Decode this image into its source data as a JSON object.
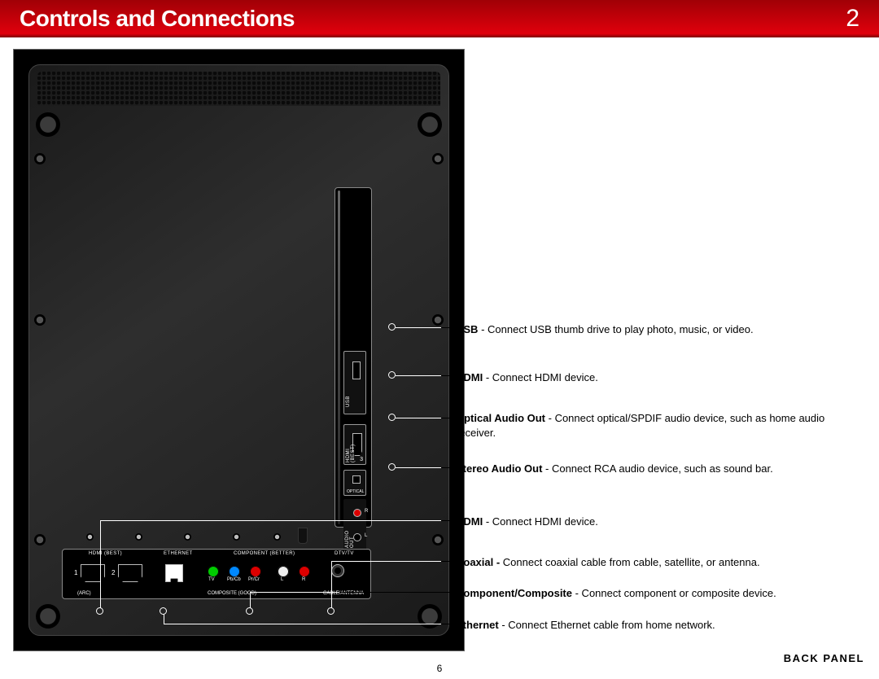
{
  "header": {
    "title": "Controls and Connections",
    "chapter": "2"
  },
  "side_ports": {
    "usb": {
      "label_v": "USB"
    },
    "hdmi": {
      "label_v": "HDMI (BEST)",
      "num": "3"
    },
    "optical": {
      "label_v": "OPTICAL"
    },
    "audio": {
      "label_v": "AUDIO OUT",
      "r": "R",
      "l": "L"
    }
  },
  "bottom_ports": {
    "hdmi_label": "HDMI (BEST)",
    "hdmi1": "1",
    "hdmi2": "2",
    "arc": "(ARC)",
    "eth_label": "ETHERNET",
    "comp_label": "COMPONENT (BETTER)",
    "compos_label": "COMPOSITE (GOOD)",
    "dtv_label": "DTV/TV",
    "ant_label": "CABLE/ANTENNA",
    "tv": "TV",
    "pb": "Pb/Cb",
    "pr": "Pr/Cr",
    "l": "L",
    "r": "R"
  },
  "callouts": [
    {
      "label": "USB",
      "text": " - Connect USB thumb drive to play photo, music, or video."
    },
    {
      "label": "HDMI",
      "text": " - Connect HDMI device."
    },
    {
      "label": "Optical Audio Out",
      "text": " - Connect optical/SPDIF audio device, such as home audio receiver."
    },
    {
      "label": "Stereo Audio Out",
      "text": " - Connect RCA audio device, such as sound bar."
    },
    {
      "label": "HDMI",
      "text": " - Connect HDMI device."
    },
    {
      "label": "Coaxial - ",
      "text": "Connect coaxial cable from cable, satellite, or antenna."
    },
    {
      "label": "Component/Composite",
      "text": " - Connect component or composite device."
    },
    {
      "label": "Ethernet",
      "text": " - Connect Ethernet cable from home network."
    }
  ],
  "panel_label": "BACK PANEL",
  "page_number": "6"
}
